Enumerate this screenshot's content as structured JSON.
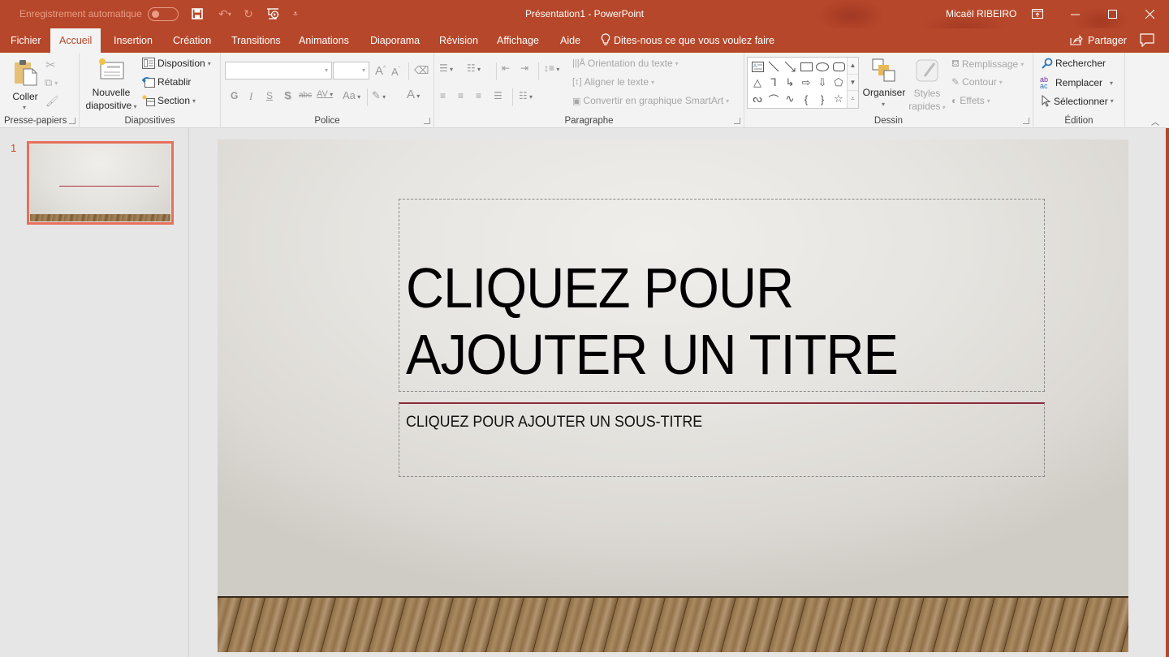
{
  "titlebar": {
    "autosave_label": "Enregistrement automatique",
    "autosave_on": false,
    "document_title": "Présentation1  -  PowerPoint",
    "user_name": "Micaël RIBEIRO",
    "quick_access": [
      "save-icon",
      "undo-icon",
      "redo-icon",
      "present-from-start-icon",
      "customize-qat-icon"
    ],
    "window_buttons": [
      "ribbon-display-options-icon",
      "minimize-icon",
      "maximize-icon",
      "close-icon"
    ]
  },
  "tabs": [
    {
      "label": "Fichier"
    },
    {
      "label": "Accueil",
      "active": true
    },
    {
      "label": "Insertion"
    },
    {
      "label": "Création"
    },
    {
      "label": "Transitions"
    },
    {
      "label": "Animations"
    },
    {
      "label": "Diaporama"
    },
    {
      "label": "Révision"
    },
    {
      "label": "Affichage"
    },
    {
      "label": "Aide"
    }
  ],
  "tell_me": "Dites-nous ce que vous voulez faire",
  "share_label": "Partager",
  "ribbon": {
    "clipboard": {
      "label": "Presse-papiers",
      "paste": "Coller"
    },
    "slides": {
      "label": "Diapositives",
      "new_slide_line1": "Nouvelle",
      "new_slide_line2": "diapositive",
      "layout": "Disposition",
      "reset": "Rétablir",
      "section": "Section"
    },
    "font": {
      "label": "Police",
      "font_name": "",
      "font_size": "",
      "bold": "G",
      "italic": "I",
      "underline": "S",
      "shadow": "S",
      "strike": "abc",
      "spacing": "AV",
      "case": "Aa",
      "color": "A"
    },
    "paragraph": {
      "label": "Paragraphe",
      "text_direction": "Orientation du texte",
      "align_text": "Aligner le texte",
      "smartart": "Convertir en graphique SmartArt"
    },
    "drawing": {
      "label": "Dessin",
      "arrange": "Organiser",
      "quick_styles_line1": "Styles",
      "quick_styles_line2": "rapides",
      "fill": "Remplissage",
      "outline": "Contour",
      "effects": "Effets"
    },
    "editing": {
      "label": "Édition",
      "find": "Rechercher",
      "replace": "Remplacer",
      "select": "Sélectionner"
    }
  },
  "thumbnails": [
    {
      "number": "1",
      "selected": true
    }
  ],
  "slide": {
    "title_line1": "CLIQUEZ POUR",
    "title_line2": "AJOUTER UN TITRE",
    "subtitle": "CLIQUEZ POUR AJOUTER UN SOUS-TITRE"
  },
  "colors": {
    "accent": "#b7472a",
    "selection": "#e8705a",
    "title_accent_line": "#8b2a3d"
  }
}
